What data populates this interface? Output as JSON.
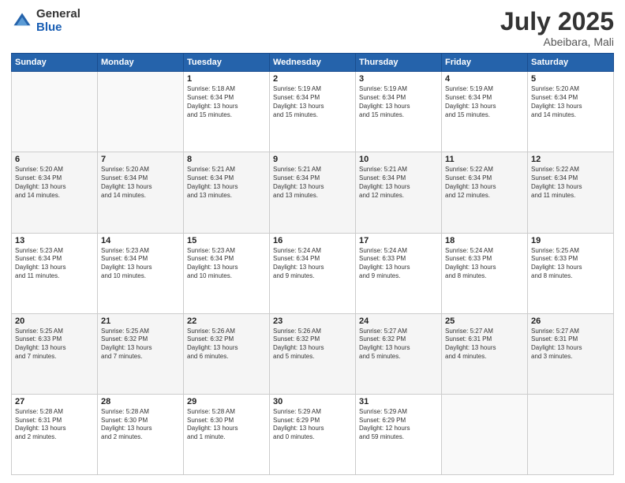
{
  "logo": {
    "general": "General",
    "blue": "Blue"
  },
  "title": {
    "month": "July 2025",
    "location": "Abeibara, Mali"
  },
  "headers": [
    "Sunday",
    "Monday",
    "Tuesday",
    "Wednesday",
    "Thursday",
    "Friday",
    "Saturday"
  ],
  "weeks": [
    [
      {
        "day": "",
        "info": ""
      },
      {
        "day": "",
        "info": ""
      },
      {
        "day": "1",
        "info": "Sunrise: 5:18 AM\nSunset: 6:34 PM\nDaylight: 13 hours\nand 15 minutes."
      },
      {
        "day": "2",
        "info": "Sunrise: 5:19 AM\nSunset: 6:34 PM\nDaylight: 13 hours\nand 15 minutes."
      },
      {
        "day": "3",
        "info": "Sunrise: 5:19 AM\nSunset: 6:34 PM\nDaylight: 13 hours\nand 15 minutes."
      },
      {
        "day": "4",
        "info": "Sunrise: 5:19 AM\nSunset: 6:34 PM\nDaylight: 13 hours\nand 15 minutes."
      },
      {
        "day": "5",
        "info": "Sunrise: 5:20 AM\nSunset: 6:34 PM\nDaylight: 13 hours\nand 14 minutes."
      }
    ],
    [
      {
        "day": "6",
        "info": "Sunrise: 5:20 AM\nSunset: 6:34 PM\nDaylight: 13 hours\nand 14 minutes."
      },
      {
        "day": "7",
        "info": "Sunrise: 5:20 AM\nSunset: 6:34 PM\nDaylight: 13 hours\nand 14 minutes."
      },
      {
        "day": "8",
        "info": "Sunrise: 5:21 AM\nSunset: 6:34 PM\nDaylight: 13 hours\nand 13 minutes."
      },
      {
        "day": "9",
        "info": "Sunrise: 5:21 AM\nSunset: 6:34 PM\nDaylight: 13 hours\nand 13 minutes."
      },
      {
        "day": "10",
        "info": "Sunrise: 5:21 AM\nSunset: 6:34 PM\nDaylight: 13 hours\nand 12 minutes."
      },
      {
        "day": "11",
        "info": "Sunrise: 5:22 AM\nSunset: 6:34 PM\nDaylight: 13 hours\nand 12 minutes."
      },
      {
        "day": "12",
        "info": "Sunrise: 5:22 AM\nSunset: 6:34 PM\nDaylight: 13 hours\nand 11 minutes."
      }
    ],
    [
      {
        "day": "13",
        "info": "Sunrise: 5:23 AM\nSunset: 6:34 PM\nDaylight: 13 hours\nand 11 minutes."
      },
      {
        "day": "14",
        "info": "Sunrise: 5:23 AM\nSunset: 6:34 PM\nDaylight: 13 hours\nand 10 minutes."
      },
      {
        "day": "15",
        "info": "Sunrise: 5:23 AM\nSunset: 6:34 PM\nDaylight: 13 hours\nand 10 minutes."
      },
      {
        "day": "16",
        "info": "Sunrise: 5:24 AM\nSunset: 6:34 PM\nDaylight: 13 hours\nand 9 minutes."
      },
      {
        "day": "17",
        "info": "Sunrise: 5:24 AM\nSunset: 6:33 PM\nDaylight: 13 hours\nand 9 minutes."
      },
      {
        "day": "18",
        "info": "Sunrise: 5:24 AM\nSunset: 6:33 PM\nDaylight: 13 hours\nand 8 minutes."
      },
      {
        "day": "19",
        "info": "Sunrise: 5:25 AM\nSunset: 6:33 PM\nDaylight: 13 hours\nand 8 minutes."
      }
    ],
    [
      {
        "day": "20",
        "info": "Sunrise: 5:25 AM\nSunset: 6:33 PM\nDaylight: 13 hours\nand 7 minutes."
      },
      {
        "day": "21",
        "info": "Sunrise: 5:25 AM\nSunset: 6:32 PM\nDaylight: 13 hours\nand 7 minutes."
      },
      {
        "day": "22",
        "info": "Sunrise: 5:26 AM\nSunset: 6:32 PM\nDaylight: 13 hours\nand 6 minutes."
      },
      {
        "day": "23",
        "info": "Sunrise: 5:26 AM\nSunset: 6:32 PM\nDaylight: 13 hours\nand 5 minutes."
      },
      {
        "day": "24",
        "info": "Sunrise: 5:27 AM\nSunset: 6:32 PM\nDaylight: 13 hours\nand 5 minutes."
      },
      {
        "day": "25",
        "info": "Sunrise: 5:27 AM\nSunset: 6:31 PM\nDaylight: 13 hours\nand 4 minutes."
      },
      {
        "day": "26",
        "info": "Sunrise: 5:27 AM\nSunset: 6:31 PM\nDaylight: 13 hours\nand 3 minutes."
      }
    ],
    [
      {
        "day": "27",
        "info": "Sunrise: 5:28 AM\nSunset: 6:31 PM\nDaylight: 13 hours\nand 2 minutes."
      },
      {
        "day": "28",
        "info": "Sunrise: 5:28 AM\nSunset: 6:30 PM\nDaylight: 13 hours\nand 2 minutes."
      },
      {
        "day": "29",
        "info": "Sunrise: 5:28 AM\nSunset: 6:30 PM\nDaylight: 13 hours\nand 1 minute."
      },
      {
        "day": "30",
        "info": "Sunrise: 5:29 AM\nSunset: 6:29 PM\nDaylight: 13 hours\nand 0 minutes."
      },
      {
        "day": "31",
        "info": "Sunrise: 5:29 AM\nSunset: 6:29 PM\nDaylight: 12 hours\nand 59 minutes."
      },
      {
        "day": "",
        "info": ""
      },
      {
        "day": "",
        "info": ""
      }
    ]
  ]
}
